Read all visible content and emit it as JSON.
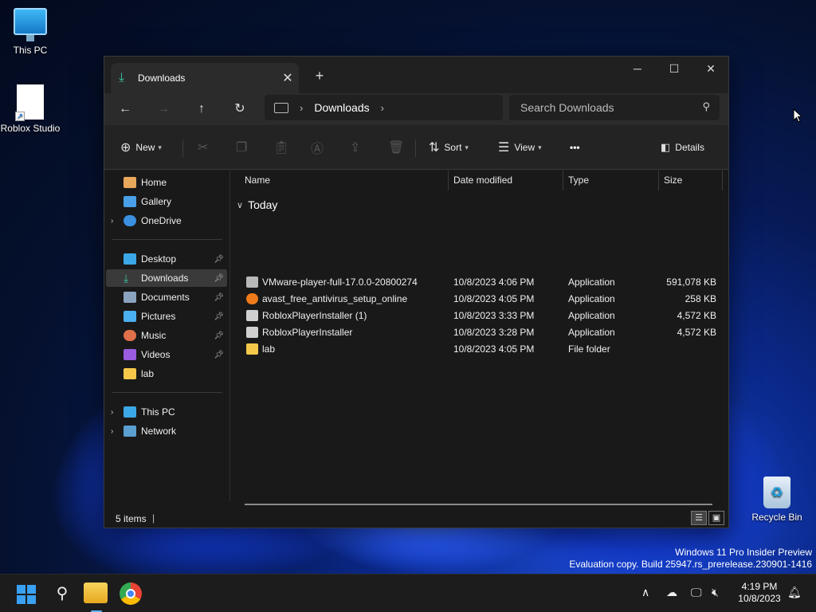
{
  "desktop": {
    "icons": [
      "This PC",
      "Roblox Studio",
      "Recycle Bin"
    ],
    "watermark": {
      "line1": "Windows 11 Pro Insider Preview",
      "line2": "Evaluation copy. Build 25947.rs_prerelease.230901-1416"
    }
  },
  "window": {
    "tab_title": "Downloads",
    "controls": {
      "minimize": "─",
      "maximize": "☐",
      "close": "✕"
    },
    "address": {
      "crumb": "Downloads"
    },
    "search": {
      "placeholder": "Search Downloads"
    },
    "commands": {
      "new": "New",
      "sort": "Sort",
      "view": "View",
      "more": "•••",
      "details": "Details"
    },
    "sidebar": {
      "quick": [
        "Home",
        "Gallery",
        "OneDrive"
      ],
      "pinned": [
        "Desktop",
        "Downloads",
        "Documents",
        "Pictures",
        "Music",
        "Videos",
        "lab"
      ],
      "devices": [
        "This PC",
        "Network"
      ]
    },
    "columns": [
      "Name",
      "Date modified",
      "Type",
      "Size"
    ],
    "group": "Today",
    "files": [
      {
        "name": "VMware-player-full-17.0.0-20800274",
        "date": "10/8/2023 4:06 PM",
        "type": "Application",
        "size": "591,078 KB"
      },
      {
        "name": "avast_free_antivirus_setup_online",
        "date": "10/8/2023 4:05 PM",
        "type": "Application",
        "size": "258 KB"
      },
      {
        "name": "RobloxPlayerInstaller (1)",
        "date": "10/8/2023 3:33 PM",
        "type": "Application",
        "size": "4,572 KB"
      },
      {
        "name": "RobloxPlayerInstaller",
        "date": "10/8/2023 3:28 PM",
        "type": "Application",
        "size": "4,572 KB"
      },
      {
        "name": "lab",
        "date": "10/8/2023 4:05 PM",
        "type": "File folder",
        "size": ""
      }
    ],
    "status": "5 items"
  },
  "taskbar": {
    "time": "4:19 PM",
    "date": "10/8/2023"
  }
}
